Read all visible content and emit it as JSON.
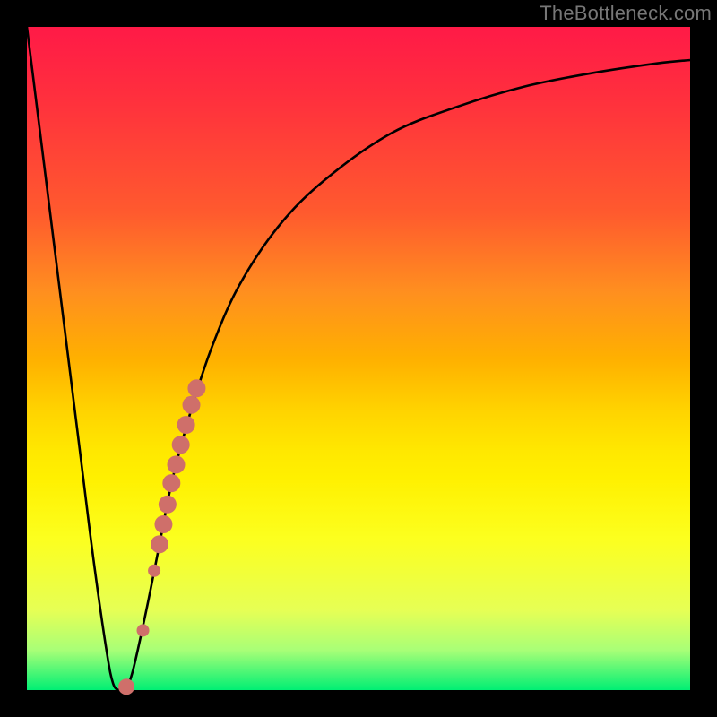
{
  "watermark": "TheBottleneck.com",
  "chart_data": {
    "type": "line",
    "title": "",
    "xlabel": "",
    "ylabel": "",
    "xlim": [
      0,
      100
    ],
    "ylim": [
      0,
      100
    ],
    "series": [
      {
        "name": "bottleneck-curve",
        "x": [
          0,
          4,
          8,
          10,
          12,
          13,
          14,
          15,
          16,
          18,
          20,
          22,
          25,
          28,
          32,
          38,
          45,
          55,
          65,
          75,
          85,
          95,
          100
        ],
        "y": [
          100,
          68,
          36,
          20,
          6,
          1,
          0,
          0.5,
          3,
          12,
          22,
          32,
          43,
          52,
          61,
          70,
          77,
          84,
          88,
          91,
          93,
          94.5,
          95
        ]
      }
    ],
    "markers": {
      "name": "highlight-dots",
      "color": "#cf6f6a",
      "points": [
        {
          "x": 15.0,
          "y": 0.5,
          "r": 9
        },
        {
          "x": 17.5,
          "y": 9.0,
          "r": 7
        },
        {
          "x": 19.2,
          "y": 18.0,
          "r": 7
        },
        {
          "x": 20.0,
          "y": 22.0,
          "r": 10
        },
        {
          "x": 20.6,
          "y": 25.0,
          "r": 10
        },
        {
          "x": 21.2,
          "y": 28.0,
          "r": 10
        },
        {
          "x": 21.8,
          "y": 31.2,
          "r": 10
        },
        {
          "x": 22.5,
          "y": 34.0,
          "r": 10
        },
        {
          "x": 23.2,
          "y": 37.0,
          "r": 10
        },
        {
          "x": 24.0,
          "y": 40.0,
          "r": 10
        },
        {
          "x": 24.8,
          "y": 43.0,
          "r": 10
        },
        {
          "x": 25.6,
          "y": 45.5,
          "r": 10
        }
      ]
    },
    "colors": {
      "curve": "#000000",
      "marker": "#cf6f6a",
      "frame": "#000000"
    }
  }
}
